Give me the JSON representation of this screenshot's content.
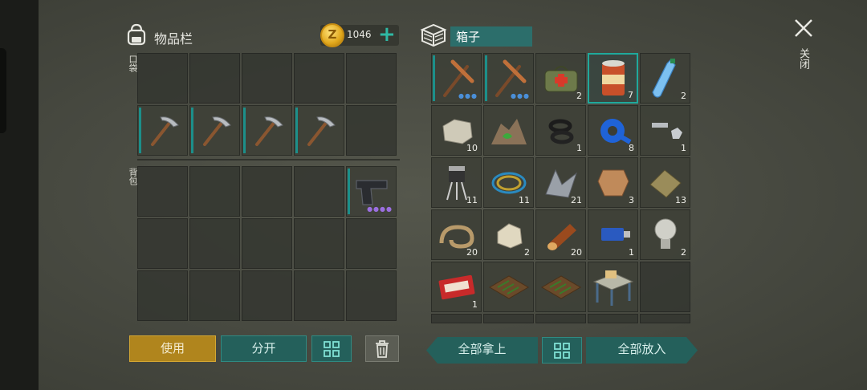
{
  "inventory": {
    "title": "物品栏",
    "coins": "1046",
    "add_coins_icon": "plus-icon"
  },
  "sections": {
    "pocket": "口袋",
    "backpack": "背包"
  },
  "pocket_slots": [
    {
      "item": "",
      "qty": ""
    },
    {
      "item": "",
      "qty": ""
    },
    {
      "item": "",
      "qty": ""
    },
    {
      "item": "",
      "qty": ""
    },
    {
      "item": "",
      "qty": ""
    },
    {
      "item": "pickaxe",
      "qty": ""
    },
    {
      "item": "pickaxe",
      "qty": ""
    },
    {
      "item": "pickaxe",
      "qty": ""
    },
    {
      "item": "pickaxe",
      "qty": ""
    },
    {
      "item": "",
      "qty": ""
    }
  ],
  "backpack_slots": [
    {
      "item": "",
      "qty": ""
    },
    {
      "item": "",
      "qty": ""
    },
    {
      "item": "",
      "qty": ""
    },
    {
      "item": "",
      "qty": ""
    },
    {
      "item": "pistol",
      "qty": "",
      "dots": "purple"
    },
    {
      "item": "",
      "qty": ""
    },
    {
      "item": "",
      "qty": ""
    },
    {
      "item": "",
      "qty": ""
    },
    {
      "item": "",
      "qty": ""
    },
    {
      "item": "",
      "qty": ""
    },
    {
      "item": "",
      "qty": ""
    },
    {
      "item": "",
      "qty": ""
    },
    {
      "item": "",
      "qty": ""
    },
    {
      "item": "",
      "qty": ""
    },
    {
      "item": "",
      "qty": ""
    }
  ],
  "chest": {
    "title": "箱子",
    "slots": [
      {
        "item": "pickaxe-copper",
        "qty": "",
        "dots": "blue"
      },
      {
        "item": "pickaxe-copper",
        "qty": "",
        "dots": "blue"
      },
      {
        "item": "first-aid-bag",
        "qty": "2"
      },
      {
        "item": "canned-food",
        "qty": "7",
        "selected": true
      },
      {
        "item": "water-bottle",
        "qty": "2"
      },
      {
        "item": "stone",
        "qty": "10"
      },
      {
        "item": "herb-pile",
        "qty": ""
      },
      {
        "item": "rubber-rings",
        "qty": "1"
      },
      {
        "item": "duct-tape",
        "qty": "8"
      },
      {
        "item": "bolt-and-nut",
        "qty": "1"
      },
      {
        "item": "transistor",
        "qty": "11"
      },
      {
        "item": "wires",
        "qty": "11"
      },
      {
        "item": "scrap-metal",
        "qty": "21"
      },
      {
        "item": "leather",
        "qty": "3"
      },
      {
        "item": "cloth",
        "qty": "13"
      },
      {
        "item": "rope",
        "qty": "20"
      },
      {
        "item": "limestone",
        "qty": "2"
      },
      {
        "item": "log",
        "qty": "20"
      },
      {
        "item": "usb-drive",
        "qty": "1"
      },
      {
        "item": "light-bulb",
        "qty": "2"
      },
      {
        "item": "coupon",
        "qty": "1"
      },
      {
        "item": "garden-bed",
        "qty": ""
      },
      {
        "item": "garden-bed",
        "qty": ""
      },
      {
        "item": "workbench",
        "qty": ""
      },
      {
        "item": "",
        "qty": ""
      }
    ]
  },
  "close": {
    "label": "关闭"
  },
  "buttons": {
    "use": "使用",
    "split": "分开",
    "take_all": "全部拿上",
    "put_all": "全部放入"
  }
}
